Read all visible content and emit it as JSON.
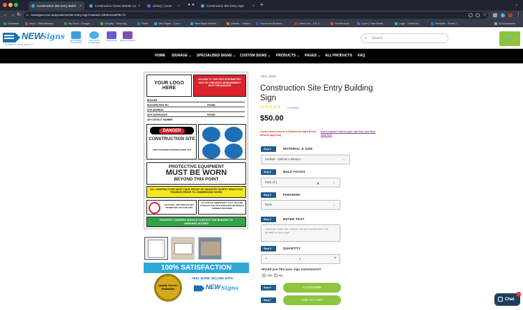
{
  "browser": {
    "tabs": [
      {
        "label": "Construction Site Entry Buildi",
        "active": true
      },
      {
        "label": "Construction Owner Builder Co",
        "active": false
      },
      {
        "label": "Library | Loom",
        "active": false
      },
      {
        "label": "Construction Site Entry Sign",
        "active": false
      }
    ],
    "new_tab": "+",
    "url": "newsigns.com.au/products/site-entry-sign?variant=44041114878173",
    "bookmarks": [
      "Dashlane",
      "Inbox - Hello@news...",
      "My Drive - Google...",
      "Shopify ~ New Sig...",
      "Trello",
      "New Signs - Conn...",
      "New Signs Websit...",
      "Zabake - Orders",
      "Facebook Busines...",
      "Listen live - 101.3...",
      "Shutterstock",
      "Loom | Free Scree...",
      "Login - ClothKnit...",
      "Sendinix - Email C...",
      "All Bookmarks"
    ]
  },
  "site": {
    "logo_main": "NEW",
    "logo_sub": "Signs",
    "logo_tagline": "CONNECT WITH QUALITY",
    "features": [
      "$1.95 Shipping Australia Wide",
      "5 Day Service Australia Wide",
      "Quick Quote",
      "Business Accounts"
    ],
    "search_placeholder": "Search",
    "nav": [
      "HOME",
      "SIGNAGE",
      "SPECIALISED SIGNS",
      "CUSTOM SIGNS",
      "PRODUCTS",
      "PAGES",
      "ALL PRODUCTS",
      "FAQ"
    ]
  },
  "sign": {
    "your_logo": "YOUR LOGO HERE",
    "access_text": "ACCESS TO THIS SITE IS PERMITTED ONLY BY PREVIOUS ARRANGEMENT WITH THE BUILDER",
    "fields": [
      "BUILDER",
      "BUILDERS REG. NO.",
      "SITE ADDRESS",
      "SITE SUPERVISOR",
      "A/H CONTACT NUMBER"
    ],
    "phone_label": "PHONE:",
    "danger": "DANGER",
    "construction_site": "CONSTRUCTION SITE",
    "unauthorised": "UNAUTHORISED PERSONS KEEP OUT",
    "protective1": "PROTECTIVE EQUIPMENT",
    "protective2": "MUST BE WORN",
    "protective3": "BEYOND THIS POINT",
    "induction": "ALL CONTRACTORS MUST HAVE PROOF OF INDUSTRY SAFETY INDUCTION TRAINING PRIOR TO COMMENCING WORK",
    "alcohol": "ALCOHOL AND DRUGS NOT PERMITTED ON THIS SITE",
    "emergency": "IN CASE OF EMERGENCY CALL 000 AND CONTACT THE SITE MANAGER ON MOBILE NUMBER PROVIDED",
    "property": "PROPERTY OWNERS SHOULD CONTACT THE BUILDER TO ARRANGE ACCESS"
  },
  "satisfaction": {
    "headline": "100% SATISFACTION",
    "feel": "FEEL MORE SECURE WITH",
    "badge": "Quality Service Reliability"
  },
  "product": {
    "sku": "SKU: 2043",
    "title": "Construction Site Entry Building Sign",
    "stars": "★★★★★",
    "reviews": "4 Reviews",
    "price": "$50.00",
    "shipping_note": "Leaves warehouse in 2-5 Business Days (From artwork approval)",
    "quote_note": "Need a quote? Add to your cart first, and then click here",
    "steps": [
      {
        "badge": "Step 1",
        "title": "MATERIAL & SIZE",
        "value": "Corflute - 600mm x 900mm"
      },
      {
        "badge": "Step 2",
        "title": "BULK PACKS",
        "value": "Pack of 1"
      },
      {
        "badge": "Step 3",
        "title": "FINISHING",
        "value": "None"
      },
      {
        "badge": "Step 4",
        "title": "ENTER TEXT",
        "value": "Optional: Enter the custom text you would like to be printed on your sign"
      },
      {
        "badge": "Step 5",
        "title": "QUANTITY",
        "value": "1"
      }
    ],
    "minus": "−",
    "plus": "+",
    "customise_question": "Would you like your sign customised?",
    "yes": "Yes",
    "no": "No",
    "step6": "Step 6",
    "customise_btn": "CUSTOMISE",
    "step7": "Step 7",
    "add_to_cart": "ADD TO CART"
  },
  "chat": {
    "label": "Chat",
    "badge": "1"
  },
  "colors": {
    "accent_green": "#8dc53e",
    "step_blue": "#1f5d8f",
    "brand_blue": "#1a6fb3",
    "danger_red": "#d9232d"
  }
}
